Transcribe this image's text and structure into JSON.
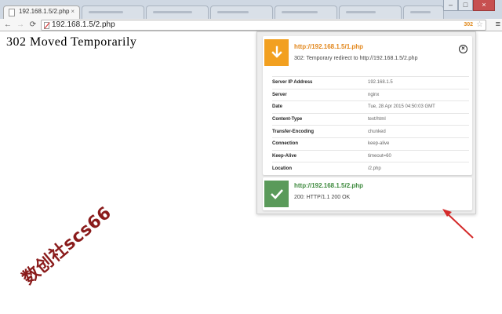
{
  "browser": {
    "active_tab": {
      "title": "192.168.1.5/2.php",
      "close": "×"
    },
    "window_controls": {
      "minimize": "–",
      "maximize": "□",
      "close": "×"
    },
    "nav": {
      "back": "←",
      "forward": "→",
      "reload": "⟳"
    },
    "address": {
      "url": "192.168.1.5/2.php",
      "redirect_badge": "302",
      "star": "☆",
      "menu": "≡"
    }
  },
  "page": {
    "heading": "302 Moved Temporarily",
    "watermark": "数创社scs66"
  },
  "popup": {
    "first_request": {
      "url": "http://192.168.1.5/1.php",
      "status": "302: Temporary redirect to http://192.168.1.5/2.php",
      "icon": "down-arrow-icon",
      "close": "×",
      "accent_color": "#f2a020",
      "headers": [
        {
          "name": "Server IP Address",
          "value": "192.168.1.5"
        },
        {
          "name": "Server",
          "value": "nginx"
        },
        {
          "name": "Date",
          "value": "Tue, 28 Apr 2015 04:50:03 GMT"
        },
        {
          "name": "Content-Type",
          "value": "text/html"
        },
        {
          "name": "Transfer-Encoding",
          "value": "chunked"
        },
        {
          "name": "Connection",
          "value": "keep-alive"
        },
        {
          "name": "Keep-Alive",
          "value": "timeout=60"
        },
        {
          "name": "Location",
          "value": "/2.php"
        }
      ]
    },
    "second_request": {
      "url": "http://192.168.1.5/2.php",
      "status": "200: HTTP/1.1 200 OK",
      "icon": "check-icon",
      "accent_color": "#5a9a5a"
    }
  }
}
